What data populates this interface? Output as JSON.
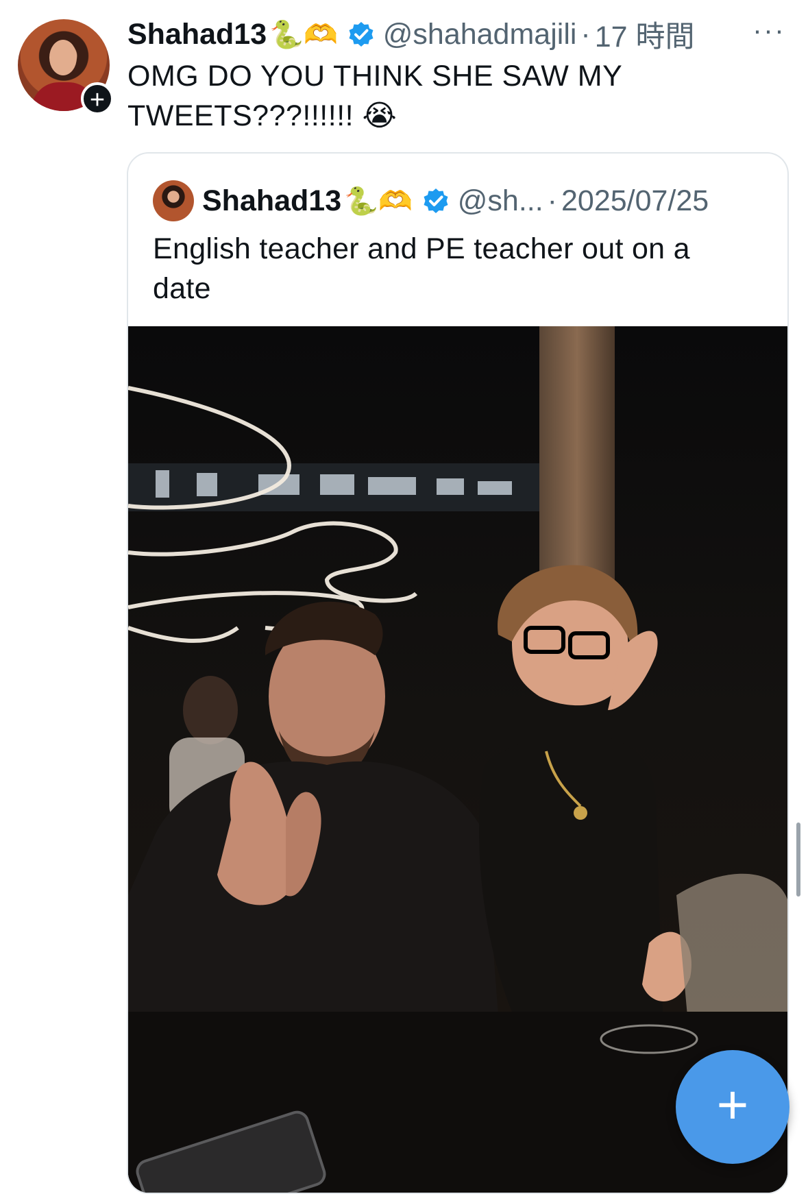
{
  "tweet": {
    "display_name": "Shahad13",
    "emojis": "🐍🫶",
    "handle": "@shahadmajili",
    "separator": "·",
    "time": "17 時間",
    "more_label": "···",
    "text": "OMG DO YOU THINK SHE SAW MY TWEETS???!!!!!! 😭"
  },
  "quoted_tweet": {
    "display_name": "Shahad13",
    "emojis": "🐍🫶",
    "handle": "@sh...",
    "separator": "·",
    "date": "2025/07/25",
    "text": "English teacher and PE teacher out on a date"
  },
  "fab": {
    "label": "+"
  },
  "follow": {
    "label": "+"
  },
  "colors": {
    "verified": "#1d9bf0",
    "fab": "#4a99e9",
    "secondary_text": "#536471"
  }
}
